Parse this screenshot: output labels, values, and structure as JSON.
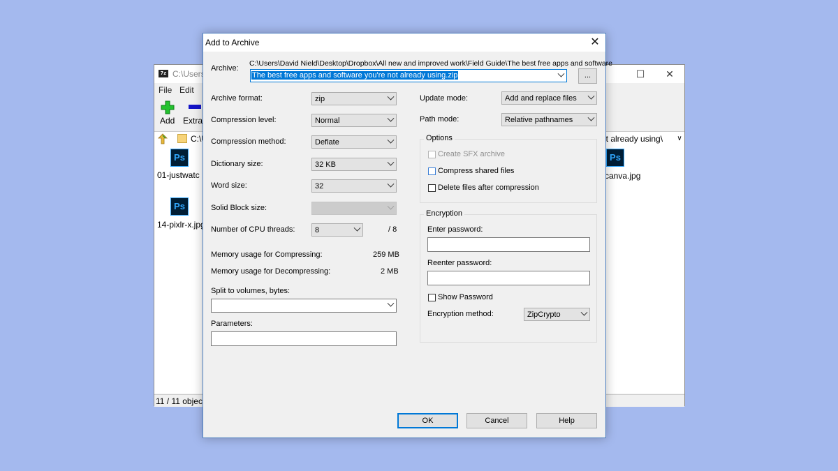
{
  "background_window": {
    "title": "C:\\Users\\",
    "app_icon": "7z",
    "window_buttons": {
      "maximize": "☐",
      "close": "✕"
    },
    "menu": {
      "file": "File",
      "edit": "Edit"
    },
    "toolbar": {
      "add_label": "Add",
      "extract_label": "Extrac"
    },
    "address_left": "C:\\U",
    "address_right": "ot already using\\",
    "files": [
      {
        "name": "01-justwatc",
        "icon": "Ps"
      },
      {
        "name": "14-pixlr-x.jpg",
        "icon": "Ps"
      },
      {
        "name": "canva.jpg",
        "icon": "Ps"
      }
    ],
    "status": "11 / 11 object("
  },
  "dialog": {
    "title": "Add to Archive",
    "close_glyph": "✕",
    "archive": {
      "label": "Archive:",
      "path": "C:\\Users\\David Nield\\Desktop\\Dropbox\\All new and improved work\\Field Guide\\The best free apps and software",
      "filename": "The best free apps and software you're not already using.zip",
      "browse_label": "..."
    },
    "archive_format": {
      "label": "Archive format:",
      "value": "zip"
    },
    "compression_level": {
      "label": "Compression level:",
      "value": "Normal"
    },
    "compression_method": {
      "label": "Compression method:",
      "value": "Deflate"
    },
    "dictionary_size": {
      "label": "Dictionary size:",
      "value": "32 KB"
    },
    "word_size": {
      "label": "Word size:",
      "value": "32"
    },
    "solid_block_size": {
      "label": "Solid Block size:",
      "value": ""
    },
    "cpu_threads": {
      "label": "Number of CPU threads:",
      "value": "8",
      "total": "/ 8"
    },
    "memory_compressing": {
      "label": "Memory usage for Compressing:",
      "value": "259 MB"
    },
    "memory_decompressing": {
      "label": "Memory usage for Decompressing:",
      "value": "2 MB"
    },
    "split_volumes": {
      "label": "Split to volumes, bytes:",
      "value": ""
    },
    "parameters": {
      "label": "Parameters:",
      "value": ""
    },
    "update_mode": {
      "label": "Update mode:",
      "value": "Add and replace files"
    },
    "path_mode": {
      "label": "Path mode:",
      "value": "Relative pathnames"
    },
    "options": {
      "title": "Options",
      "create_sfx": "Create SFX archive",
      "compress_shared": "Compress shared files",
      "delete_after": "Delete files after compression"
    },
    "encryption": {
      "title": "Encryption",
      "enter_password": "Enter password:",
      "reenter_password": "Reenter password:",
      "show_password": "Show Password",
      "method_label": "Encryption method:",
      "method_value": "ZipCrypto"
    },
    "buttons": {
      "ok": "OK",
      "cancel": "Cancel",
      "help": "Help"
    }
  },
  "colors": {
    "desktop": "#a4b9ee",
    "selection": "#0078d7",
    "add_icon": "#22c22e",
    "ps_icon_bg": "#001e36",
    "ps_icon_fg": "#31a8ff"
  }
}
